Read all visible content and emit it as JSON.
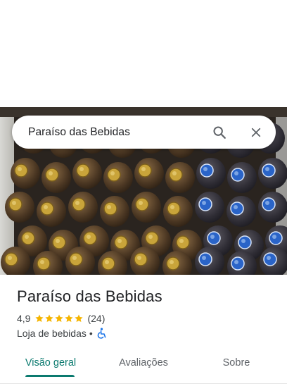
{
  "search": {
    "query": "Paraíso das Bebidas",
    "search_icon": "search-icon",
    "close_icon": "close-icon"
  },
  "place": {
    "name": "Paraíso das Bebidas",
    "rating": "4,9",
    "stars": 5,
    "review_count": "(24)",
    "category": "Loja de bebidas",
    "separator": "•",
    "accessibility_icon": "wheelchair-icon"
  },
  "tabs": [
    {
      "label": "Visão geral",
      "active": true
    },
    {
      "label": "Avaliações",
      "active": false
    },
    {
      "label": "Sobre",
      "active": false
    }
  ],
  "colors": {
    "accent": "#0b7a6f",
    "star": "#f5b400",
    "wheelchair": "#1a73e8",
    "bottle_cap_gold": "#c9a43a",
    "bottle_cap_blue": "#2a64c8"
  }
}
